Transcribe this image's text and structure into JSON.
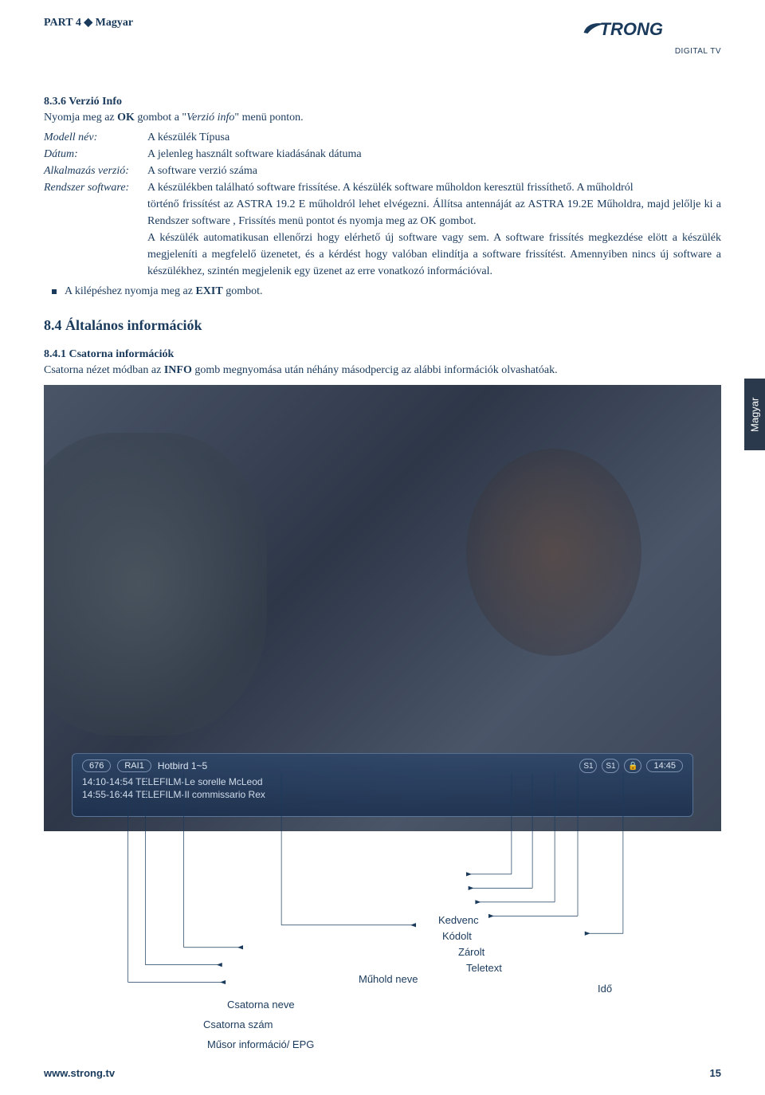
{
  "header": {
    "part": "PART 4",
    "lang": "Magyar",
    "logo_sub": "DIGITAL TV"
  },
  "section_836": {
    "title": "8.3.6 Verzió Info",
    "intro_pre": "Nyomja meg az ",
    "intro_ok": "OK",
    "intro_mid": " gombot a \"",
    "intro_italic": "Verzió info",
    "intro_post": "\" menü ponton.",
    "rows": [
      {
        "label": "Modell név:",
        "value": "A készülék Típusa"
      },
      {
        "label": "Dátum:",
        "value": "A jelenleg használt software kiadásának dátuma"
      },
      {
        "label": "Alkalmazás verzió:",
        "value": "A software verzió száma"
      },
      {
        "label": "Rendszer software:",
        "value": "A készülékben található software frissítése. A készülék software műholdon keresztül frissíthető. A műholdról"
      }
    ],
    "body": "történő frissítést az ASTRA 19.2 E műholdról lehet elvégezni. Állítsa antennáját az ASTRA 19.2E Műholdra, majd jelőlje ki a Rendszer software , Frissítés menü pontot és nyomja meg az OK gombot.\nA készülék automatikusan ellenőrzi hogy elérhető új software vagy sem. A software frissítés megkezdése elött a készülék megjeleníti a megfelelő üzenetet, és a kérdést hogy valóban elindítja a software frissítést. Amennyiben nincs új software a készülékhez, szintén megjelenik egy üzenet az erre vonatkozó információval.",
    "bullet_pre": "A kilépéshez nyomja meg az ",
    "bullet_bold": "EXIT",
    "bullet_post": " gombot."
  },
  "heading_84": "8.4 Általános információk",
  "section_841": {
    "title": "8.4.1 Csatorna információk",
    "intro_pre": "Csatorna nézet módban az ",
    "intro_bold": "INFO",
    "intro_post": " gomb megnyomása után néhány másodpercig az alábbi információk olvashatóak."
  },
  "banner": {
    "chnum": "676",
    "chname": "RAI1",
    "sat": "Hotbird 1~5",
    "s1": "S1",
    "s2": "S1",
    "time": "14:45",
    "line1": "14:10-14:54  TELEFILM-Le sorelle McLeod",
    "line2": "14:55-16:44  TELEFILM-Il commissario Rex"
  },
  "annotations": {
    "kedvenc": "Kedvenc",
    "kodolt": "Kódolt",
    "zarolt": "Zárolt",
    "teletext": "Teletext",
    "muhold": "Műhold neve",
    "ido": "Idő",
    "csatorna_neve": "Csatorna neve",
    "csatorna_szam": "Csatorna szám",
    "musor": "Műsor információ/ EPG"
  },
  "side_tab": "Magyar",
  "footer": {
    "url": "www.strong.tv",
    "page": "15"
  }
}
